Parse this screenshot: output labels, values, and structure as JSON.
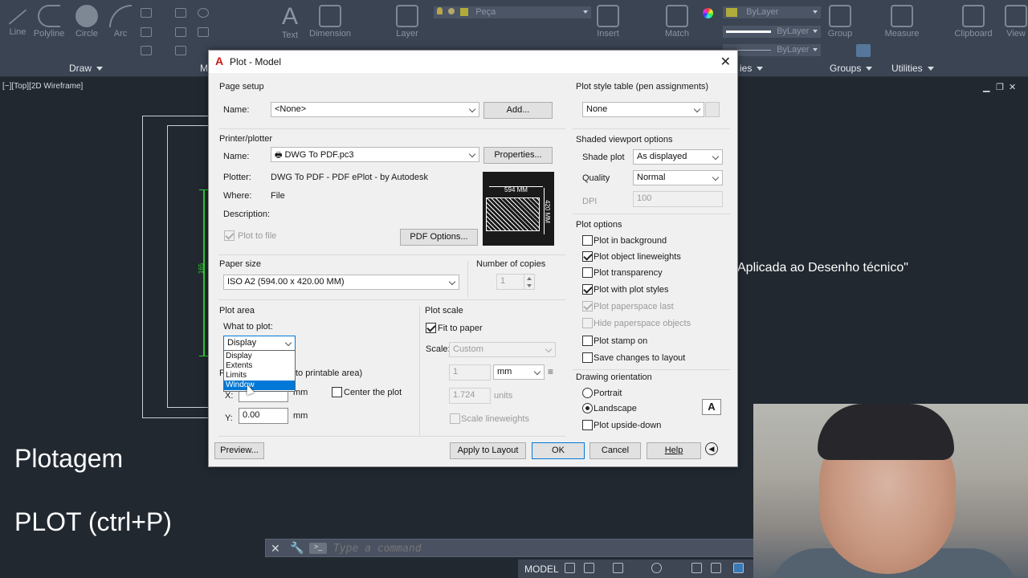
{
  "ribbon": {
    "tools": [
      {
        "label": "Line",
        "icon": "line-icon"
      },
      {
        "label": "Polyline",
        "icon": "polyline-icon"
      },
      {
        "label": "Circle",
        "icon": "circle-icon"
      },
      {
        "label": "Arc",
        "icon": "arc-icon"
      },
      {
        "label": "Text",
        "icon": "text-icon"
      },
      {
        "label": "Dimension",
        "icon": "dimension-icon"
      },
      {
        "label": "Layer",
        "icon": "layer-icon"
      },
      {
        "label": "Insert",
        "icon": "insert-icon"
      },
      {
        "label": "Match",
        "icon": "match-properties-icon"
      },
      {
        "label": "Group",
        "icon": "group-icon"
      },
      {
        "label": "Measure",
        "icon": "measure-icon"
      },
      {
        "label": "Clipboard",
        "icon": "clipboard-icon"
      },
      {
        "label": "View",
        "icon": "view-icon"
      }
    ],
    "layer_value": "Peça",
    "bylayer_color": "ByLayer",
    "bylayer_linetype": "ByLayer",
    "bylayer_lineweight": "ByLayer",
    "panels": {
      "draw": "Draw",
      "modify_partial": "M",
      "properties_partial": "ies",
      "groups": "Groups",
      "utilities": "Utilities"
    }
  },
  "drawing": {
    "viewport_label": "[−][Top][2D Wireframe]",
    "dim_label": "165",
    "title_fragment": "Aplicada ao Desenho técnico\"",
    "overlay_title": "Plotagem",
    "overlay_command": "PLOT (ctrl+P)"
  },
  "command_line": {
    "placeholder": "Type a command"
  },
  "status_bar": {
    "model": "MODEL"
  },
  "dialog": {
    "title": "Plot - Model",
    "page_setup": {
      "group": "Page setup",
      "name_label": "Name:",
      "name_value": "<None>",
      "add_button": "Add..."
    },
    "printer": {
      "group": "Printer/plotter",
      "name_label": "Name:",
      "name_value": "DWG To PDF.pc3",
      "properties_button": "Properties...",
      "plotter_label": "Plotter:",
      "plotter_value": "DWG To PDF - PDF ePlot - by Autodesk",
      "where_label": "Where:",
      "where_value": "File",
      "description_label": "Description:",
      "plot_to_file": "Plot to file",
      "pdf_options_button": "PDF Options...",
      "preview_width": "594 MM",
      "preview_height": "420 MM"
    },
    "paper_size": {
      "group": "Paper size",
      "value": "ISO A2 (594.00 x 420.00 MM)"
    },
    "copies": {
      "label": "Number of copies",
      "value": "1"
    },
    "plot_area": {
      "group": "Plot area",
      "what_label": "What to plot:",
      "selected": "Display",
      "options": [
        "Display",
        "Extents",
        "Limits",
        "Window"
      ],
      "highlighted": "Window"
    },
    "plot_offset": {
      "group_partial": "P",
      "group_suffix": "to printable area)",
      "x_label": "X:",
      "x_unit": "mm",
      "y_label": "Y:",
      "y_value": "0.00",
      "y_unit": "mm",
      "center": "Center the plot"
    },
    "plot_scale": {
      "group": "Plot scale",
      "fit_to_paper": "Fit to paper",
      "scale_label": "Scale:",
      "scale_value": "Custom",
      "value1": "1",
      "unit1": "mm",
      "value2": "1.724",
      "unit2": "units",
      "scale_lineweights": "Scale lineweights"
    },
    "plot_style_table": {
      "group": "Plot style table (pen assignments)",
      "value": "None"
    },
    "shaded_viewport": {
      "group": "Shaded viewport options",
      "shade_label": "Shade plot",
      "shade_value": "As displayed",
      "quality_label": "Quality",
      "quality_value": "Normal",
      "dpi_label": "DPI",
      "dpi_value": "100"
    },
    "plot_options": {
      "group": "Plot options",
      "items": [
        {
          "label": "Plot in background",
          "checked": false,
          "enabled": true
        },
        {
          "label": "Plot object lineweights",
          "checked": true,
          "enabled": true
        },
        {
          "label": "Plot transparency",
          "checked": false,
          "enabled": true
        },
        {
          "label": "Plot with plot styles",
          "checked": true,
          "enabled": true
        },
        {
          "label": "Plot paperspace last",
          "checked": true,
          "enabled": false
        },
        {
          "label": "Hide paperspace objects",
          "checked": false,
          "enabled": false
        },
        {
          "label": "Plot stamp on",
          "checked": false,
          "enabled": true
        },
        {
          "label": "Save changes to layout",
          "checked": false,
          "enabled": true
        }
      ]
    },
    "orientation": {
      "group": "Drawing orientation",
      "portrait": "Portrait",
      "landscape": "Landscape",
      "upside_down": "Plot upside-down",
      "icon_letter": "A"
    },
    "buttons": {
      "preview": "Preview...",
      "apply": "Apply to Layout",
      "ok": "OK",
      "cancel": "Cancel",
      "help": "Help"
    }
  }
}
